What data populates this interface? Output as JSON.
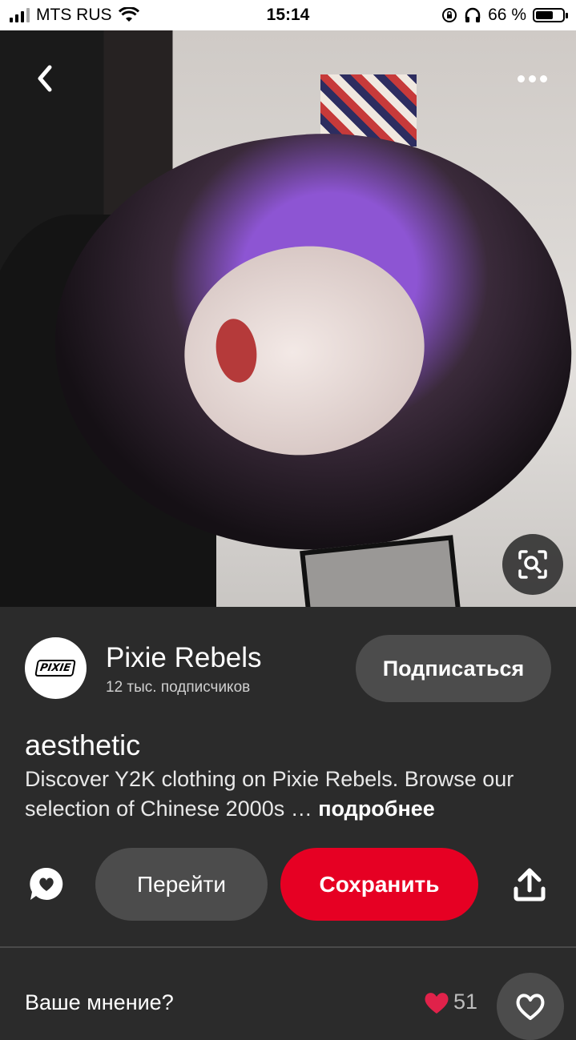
{
  "status_bar": {
    "carrier": "MTS RUS",
    "time": "15:14",
    "battery": "66 %",
    "battery_level": 0.66
  },
  "pin": {
    "image_alt": "",
    "author": {
      "name": "Pixie Rebels",
      "followers": "12 тыс. подписчиков",
      "avatar_text": "PIXIE"
    },
    "follow_label": "Подписаться",
    "title": "aesthetic",
    "description": "Discover Y2K clothing on Pixie Rebels. Browse our selection of Chinese 2000s …",
    "more_label": "подробнее"
  },
  "actions": {
    "visit_label": "Перейти",
    "save_label": "Сохранить"
  },
  "feedback": {
    "prompt": "Ваше мнение?",
    "reaction_count": "51"
  },
  "colors": {
    "background": "#2b2b2b",
    "button_gray": "#4c4c4c",
    "save_red": "#e60023",
    "reaction_red": "#e0224a"
  },
  "icons": [
    "back-icon",
    "more-icon",
    "visual-search-icon",
    "comment-icon",
    "share-icon",
    "heart-icon"
  ]
}
